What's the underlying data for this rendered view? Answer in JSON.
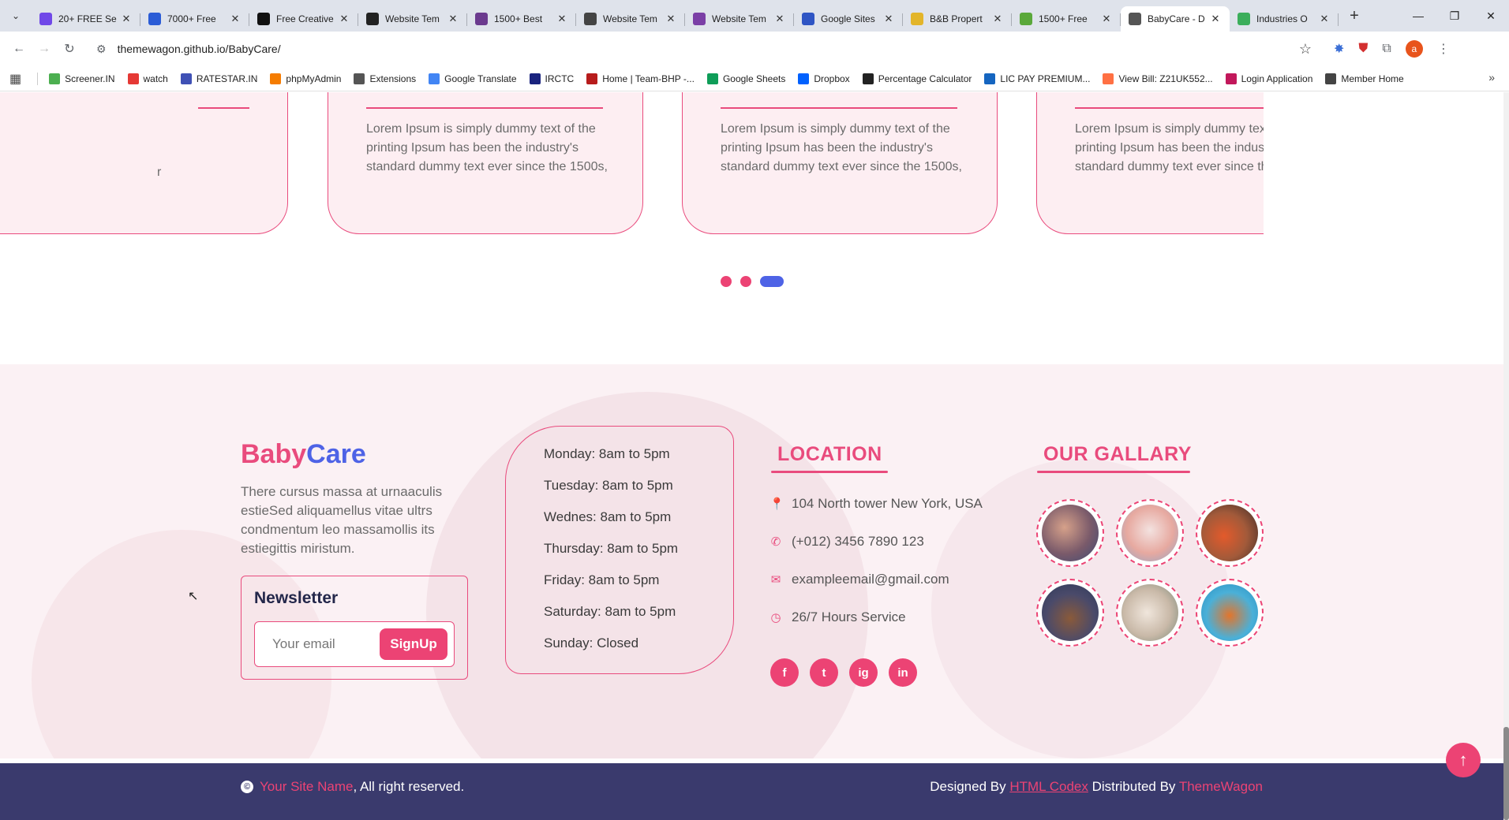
{
  "browser": {
    "tabs": [
      {
        "title": "20+ FREE Se",
        "icon_color": "#7048e8",
        "active": false
      },
      {
        "title": "7000+ Free",
        "icon_color": "#2b5cd6",
        "active": false
      },
      {
        "title": "Free Creative",
        "icon_color": "#111111",
        "active": false
      },
      {
        "title": "Website Tem",
        "icon_color": "#222222",
        "active": false
      },
      {
        "title": "1500+ Best",
        "icon_color": "#6b3a8e",
        "active": false
      },
      {
        "title": "Website Tem",
        "icon_color": "#444444",
        "active": false
      },
      {
        "title": "Website Tem",
        "icon_color": "#7b3fa6",
        "active": false
      },
      {
        "title": "Google Sites",
        "icon_color": "#2f55c4",
        "active": false
      },
      {
        "title": "B&B Propert",
        "icon_color": "#e3b52a",
        "active": false
      },
      {
        "title": "1500+ Free",
        "icon_color": "#5aa83a",
        "active": false
      },
      {
        "title": "BabyCare - D",
        "icon_color": "#555555",
        "active": true
      },
      {
        "title": "Industries O",
        "icon_color": "#3cae5b",
        "active": false
      }
    ],
    "url": "themewagon.github.io/BabyCare/",
    "profile_initial": "a",
    "bookmarks": [
      {
        "label": "Screener.IN",
        "color": "#4caf50"
      },
      {
        "label": "watch",
        "color": "#e53935"
      },
      {
        "label": "RATESTAR.IN",
        "color": "#3f51b5"
      },
      {
        "label": "phpMyAdmin",
        "color": "#f57c00"
      },
      {
        "label": "Extensions",
        "color": "#555555"
      },
      {
        "label": "Google Translate",
        "color": "#4285f4"
      },
      {
        "label": "IRCTC",
        "color": "#1a237e"
      },
      {
        "label": "Home | Team-BHP -...",
        "color": "#b71c1c"
      },
      {
        "label": "Google Sheets",
        "color": "#0f9d58"
      },
      {
        "label": "Dropbox",
        "color": "#0061fe"
      },
      {
        "label": "Percentage Calculator",
        "color": "#222222"
      },
      {
        "label": "LIC PAY PREMIUM...",
        "color": "#1565c0"
      },
      {
        "label": "View Bill: Z21UK552...",
        "color": "#ff7043"
      },
      {
        "label": "Login Application",
        "color": "#c2185b"
      },
      {
        "label": "Member Home",
        "color": "#444444"
      }
    ]
  },
  "testimonials": {
    "text": "Lorem Ipsum is simply dummy text of the printing Ipsum has been the industry's standard dummy text ever since the 1500s,",
    "stars": "★★★★★"
  },
  "footer": {
    "brand_part1": "Baby",
    "brand_part2": "Care",
    "about": "There cursus massa at urnaaculis estieSed aliquamellus vitae ultrs condmentum leo massamollis its estiegittis miristum.",
    "newsletter_title": "Newsletter",
    "email_placeholder": "Your email",
    "signup_label": "SignUp",
    "hours": [
      "Monday: 8am to 5pm",
      "Tuesday: 8am to 5pm",
      "Wednes: 8am to 5pm",
      "Thursday: 8am to 5pm",
      "Friday: 8am to 5pm",
      "Saturday: 8am to 5pm",
      "Sunday: Closed"
    ],
    "location_title": "LOCATION",
    "location": {
      "address": "104 North tower New York, USA",
      "phone": "(+012) 3456 7890 123",
      "email": "exampleemail@gmail.com",
      "service": "26/7 Hours Service"
    },
    "social": [
      "f",
      "t",
      "ig",
      "in"
    ],
    "gallery_title": "OUR GALLARY",
    "copyright_site": "Your Site Name",
    "copyright_rest": ", All right reserved.",
    "designed_by": "Designed By",
    "designer": "HTML Codex",
    "distributed_by": "Distributed By",
    "distributor": "ThemeWagon"
  },
  "colors": {
    "accent_pink": "#ec4374",
    "accent_blue": "#4e63e6",
    "footer_bar": "#3a3a6d"
  }
}
